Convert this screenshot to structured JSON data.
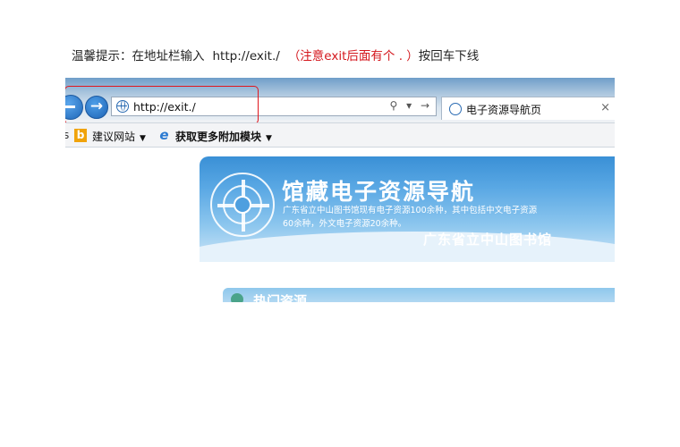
{
  "tip": {
    "prefix": "温馨提示：在地址栏输入",
    "url": "http://exit./",
    "note": "（注意exit后面有个 . ）",
    "suffix": "按回车下线"
  },
  "browser": {
    "address_url": "http://exit./",
    "address_controls": "⚲ ▾ →",
    "tab_title": "电子资源导航页",
    "tab_close": "×",
    "favorites": {
      "fragment": "s",
      "item1": "建议网站",
      "item2": "获取更多附加模块",
      "caret": "▼"
    }
  },
  "page": {
    "banner_title": "馆藏电子资源导航",
    "banner_desc": "广东省立中山图书馆现有电子资源100余种，其中包括中文电子资源60余种，外文电子资源20余种。",
    "banner_org": "广东省立中山图书馆",
    "section_label": "热门资源"
  },
  "colors": {
    "note_red": "#d4161c",
    "highlight_box": "#e0161d",
    "banner_blue": "#3a90d6"
  }
}
